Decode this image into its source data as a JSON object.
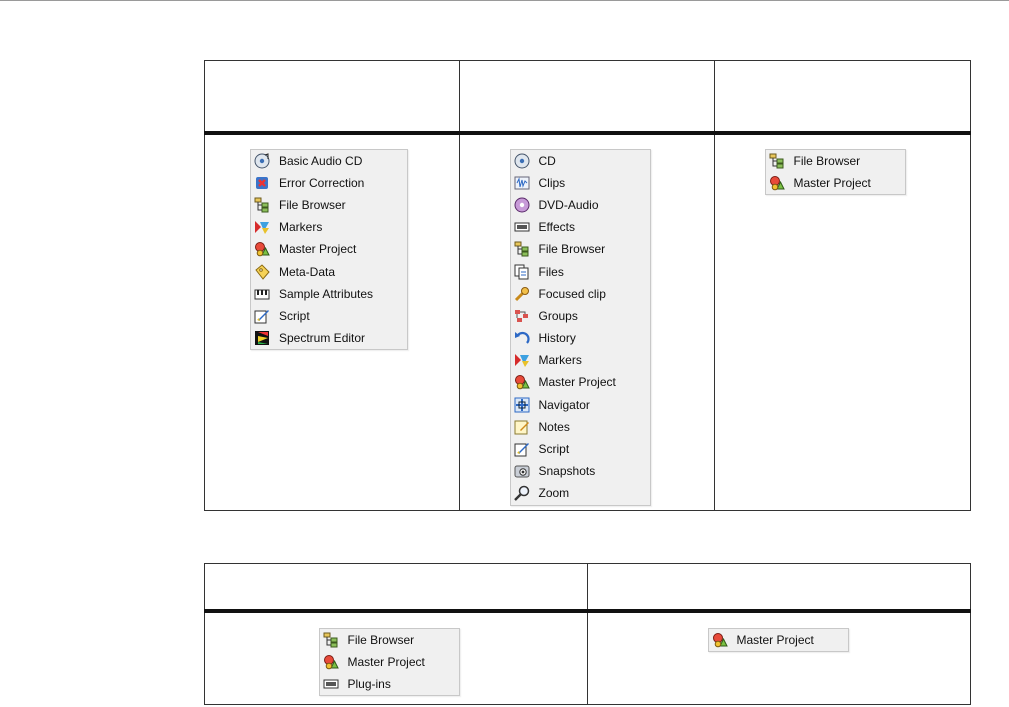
{
  "table1": {
    "headers": [
      "",
      "",
      ""
    ],
    "menus": [
      [
        {
          "label": "Basic Audio CD",
          "icon": "basic-audio-cd-icon"
        },
        {
          "label": "Error Correction",
          "icon": "error-correction-icon"
        },
        {
          "label": "File Browser",
          "icon": "file-browser-icon"
        },
        {
          "label": "Markers",
          "icon": "markers-icon"
        },
        {
          "label": "Master Project",
          "icon": "master-project-icon"
        },
        {
          "label": "Meta-Data",
          "icon": "meta-data-icon"
        },
        {
          "label": "Sample Attributes",
          "icon": "sample-attributes-icon"
        },
        {
          "label": "Script",
          "icon": "script-icon"
        },
        {
          "label": "Spectrum Editor",
          "icon": "spectrum-editor-icon"
        }
      ],
      [
        {
          "label": "CD",
          "icon": "cd-icon"
        },
        {
          "label": "Clips",
          "icon": "clips-icon"
        },
        {
          "label": "DVD-Audio",
          "icon": "dvd-audio-icon"
        },
        {
          "label": "Effects",
          "icon": "effects-icon"
        },
        {
          "label": "File Browser",
          "icon": "file-browser-icon"
        },
        {
          "label": "Files",
          "icon": "files-icon"
        },
        {
          "label": "Focused clip",
          "icon": "focused-clip-icon"
        },
        {
          "label": "Groups",
          "icon": "groups-icon"
        },
        {
          "label": "History",
          "icon": "history-icon"
        },
        {
          "label": "Markers",
          "icon": "markers-icon"
        },
        {
          "label": "Master Project",
          "icon": "master-project-icon"
        },
        {
          "label": "Navigator",
          "icon": "navigator-icon"
        },
        {
          "label": "Notes",
          "icon": "notes-icon"
        },
        {
          "label": "Script",
          "icon": "script-icon"
        },
        {
          "label": "Snapshots",
          "icon": "snapshots-icon"
        },
        {
          "label": "Zoom",
          "icon": "zoom-icon"
        }
      ],
      [
        {
          "label": "File Browser",
          "icon": "file-browser-icon"
        },
        {
          "label": "Master Project",
          "icon": "master-project-icon"
        }
      ]
    ]
  },
  "table2": {
    "headers": [
      "",
      ""
    ],
    "menus": [
      [
        {
          "label": "File Browser",
          "icon": "file-browser-icon"
        },
        {
          "label": "Master Project",
          "icon": "master-project-icon"
        },
        {
          "label": "Plug-ins",
          "icon": "plug-ins-icon"
        }
      ],
      [
        {
          "label": "Master Project",
          "icon": "master-project-icon"
        }
      ]
    ]
  }
}
